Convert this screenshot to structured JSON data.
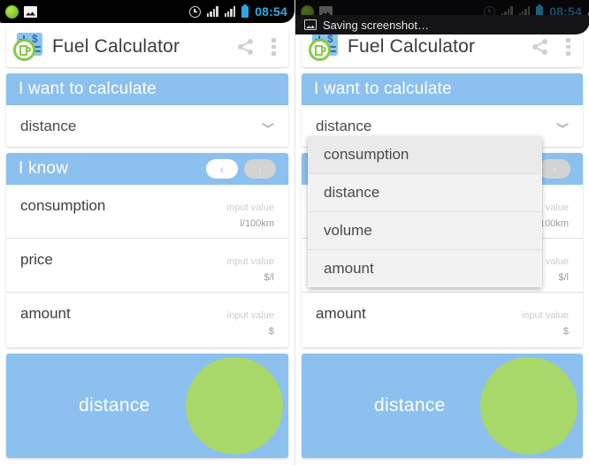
{
  "app": {
    "title": "Fuel Calculator",
    "logo_icon": "fuel-calculator-logo",
    "share_icon": "share-icon",
    "overflow_icon": "overflow-menu-icon"
  },
  "statusbar": {
    "clock": "08:54",
    "icons": [
      "app-notification-icon",
      "screenshot-image-icon",
      "alarm-icon",
      "signal-icon",
      "signal-icon",
      "battery-icon"
    ],
    "clock_color": "#35a9e2"
  },
  "notification": {
    "text": "Saving screenshot…",
    "icon": "screenshot-image-icon"
  },
  "sections": {
    "calculate": {
      "header": "I want to calculate",
      "selected": "distance",
      "chevron_icon": "chevron-down-icon"
    },
    "know": {
      "header": "I know",
      "prev_label": "‹",
      "next_label": "›"
    }
  },
  "fields": [
    {
      "label": "consumption",
      "placeholder": "input value",
      "value": "",
      "unit": "l/100km"
    },
    {
      "label": "price",
      "placeholder": "input value",
      "value": "",
      "unit": "$/l"
    },
    {
      "label": "amount",
      "placeholder": "input value",
      "value": "",
      "unit": "$"
    }
  ],
  "result": {
    "label": "distance",
    "bubble_color": "#a8d86a",
    "panel_color": "#8cc0ee"
  },
  "dropdown": {
    "options": [
      "consumption",
      "distance",
      "volume",
      "amount"
    ],
    "selected_index": 0
  },
  "theme": {
    "accent_blue": "#8cc0ee",
    "accent_green": "#a8d86a",
    "text_dark": "#3d3d3d",
    "hint_gray": "#cccccc"
  }
}
